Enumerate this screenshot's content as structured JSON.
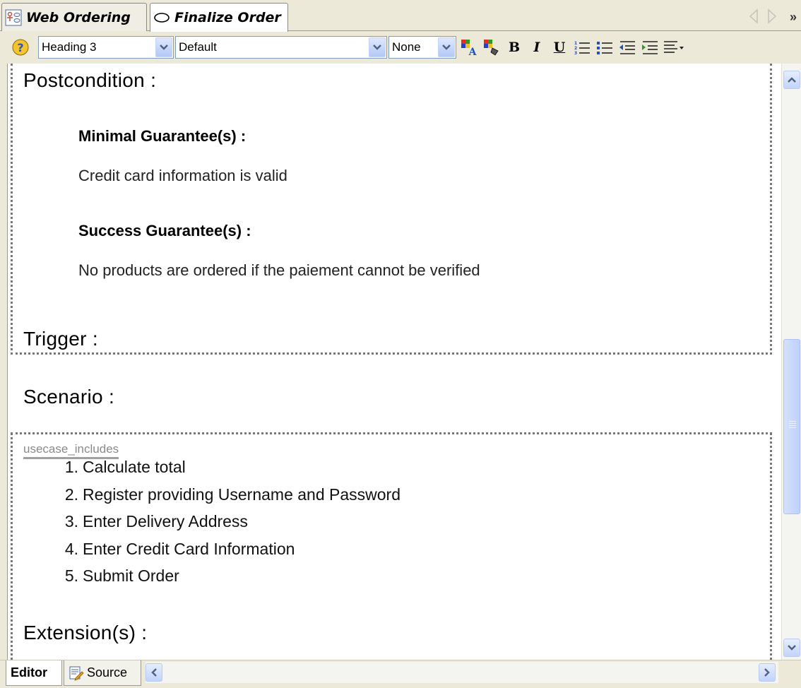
{
  "tabs": [
    {
      "label": "Web Ordering",
      "icon": "diagram-icon",
      "active": false
    },
    {
      "label": "Finalize Order",
      "icon": "usecase-ellipse-icon",
      "active": true
    }
  ],
  "toolbar": {
    "style_value": "Heading 3",
    "font_value": "Default",
    "size_value": "None",
    "bold_label": "B",
    "italic_label": "I",
    "underline_label": "U"
  },
  "document": {
    "postcondition_heading": "Postcondition :",
    "minimal_heading": "Minimal Guarantee(s) :",
    "minimal_text": "Credit card information is valid",
    "success_heading": "Success Guarantee(s) :",
    "success_text": "No products are ordered if the paiement cannot be verified",
    "trigger_heading": "Trigger :",
    "scenario_heading": "Scenario :",
    "includes_tag": "usecase_includes",
    "steps": [
      {
        "num": "1.",
        "text": "Calculate total"
      },
      {
        "num": "2.",
        "text": "Register providing Username and Password"
      },
      {
        "num": "3.",
        "text": "Enter Delivery Address"
      },
      {
        "num": "4.",
        "text": "Enter Credit Card Information"
      },
      {
        "num": "5.",
        "text": "Submit Order"
      }
    ],
    "extension_heading": "Extension(s) :"
  },
  "bottom_tabs": [
    {
      "label": "Editor",
      "active": true
    },
    {
      "label": "Source",
      "active": false,
      "icon": "source-edit-icon"
    }
  ]
}
